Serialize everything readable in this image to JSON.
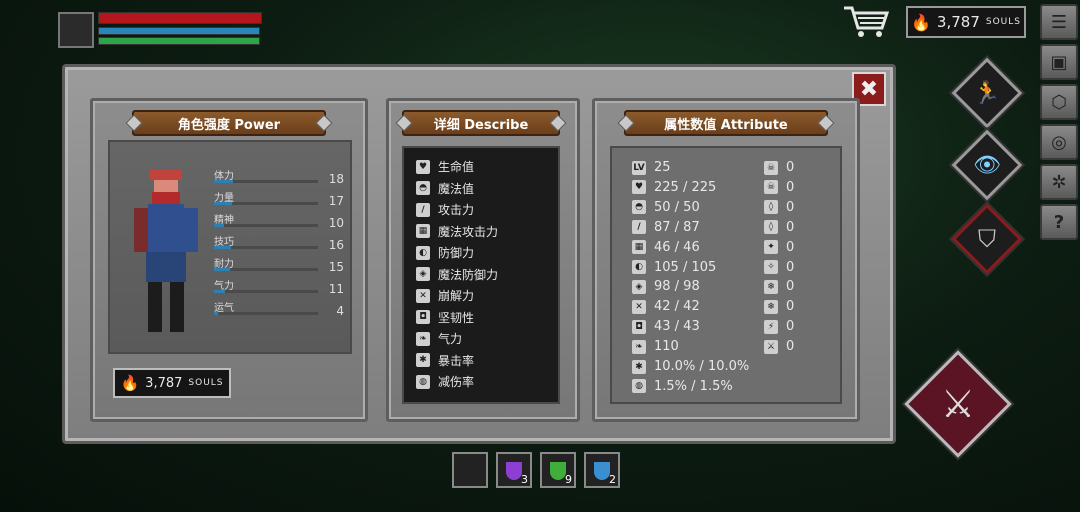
{
  "hud": {
    "souls": {
      "amount": "3,787",
      "unit": "SOULS"
    },
    "icons": [
      "shopping-cart-icon",
      "menu-list-icon",
      "backpack-icon",
      "armor-icon",
      "settings-icon",
      "gear-icon",
      "help-icon",
      "run-icon",
      "eye-icon",
      "shield-icon",
      "crossed-swords-icon"
    ],
    "help_label": "?",
    "close_label": "✖"
  },
  "power": {
    "title": "角色强度 Power",
    "stats": [
      {
        "label": "体力",
        "value": "18",
        "level": 0.18
      },
      {
        "label": "力量",
        "value": "17",
        "level": 0.17
      },
      {
        "label": "精神",
        "value": "10",
        "level": 0.1
      },
      {
        "label": "技巧",
        "value": "16",
        "level": 0.16
      },
      {
        "label": "耐力",
        "value": "15",
        "level": 0.15
      },
      {
        "label": "气力",
        "value": "11",
        "level": 0.11
      },
      {
        "label": "运气",
        "value": "4",
        "level": 0.04
      }
    ],
    "souls": {
      "amount": "3,787",
      "unit": "SOULS"
    }
  },
  "describe": {
    "title": "详细 Describe",
    "items": [
      "生命值",
      "魔法值",
      "攻击力",
      "魔法攻击力",
      "防御力",
      "魔法防御力",
      "崩解力",
      "坚韧性",
      "气力",
      "暴击率",
      "减伤率"
    ]
  },
  "attribute": {
    "title": "属性数值 Attribute",
    "level_icon": "LV",
    "left": [
      "25",
      "225 / 225",
      "50 / 50",
      "87 / 87",
      "46 / 46",
      "105 / 105",
      "98 / 98",
      "42 / 42",
      "43 / 43",
      "110",
      "10.0% / 10.0%",
      "1.5% / 1.5%"
    ],
    "right": [
      "0",
      "0",
      "0",
      "0",
      "0",
      "0",
      "0",
      "0",
      "0",
      "0"
    ]
  },
  "quickbar": {
    "slots": [
      {
        "name": "empty-slot",
        "count": ""
      },
      {
        "name": "purple-potion",
        "count": "3"
      },
      {
        "name": "green-potion",
        "count": "9"
      },
      {
        "name": "blue-potion",
        "count": "2"
      }
    ]
  },
  "colors": {
    "hp": "#b5161b",
    "mp": "#2a86b8",
    "stamina": "#2ea34a",
    "accent": "#8b5a2c"
  }
}
